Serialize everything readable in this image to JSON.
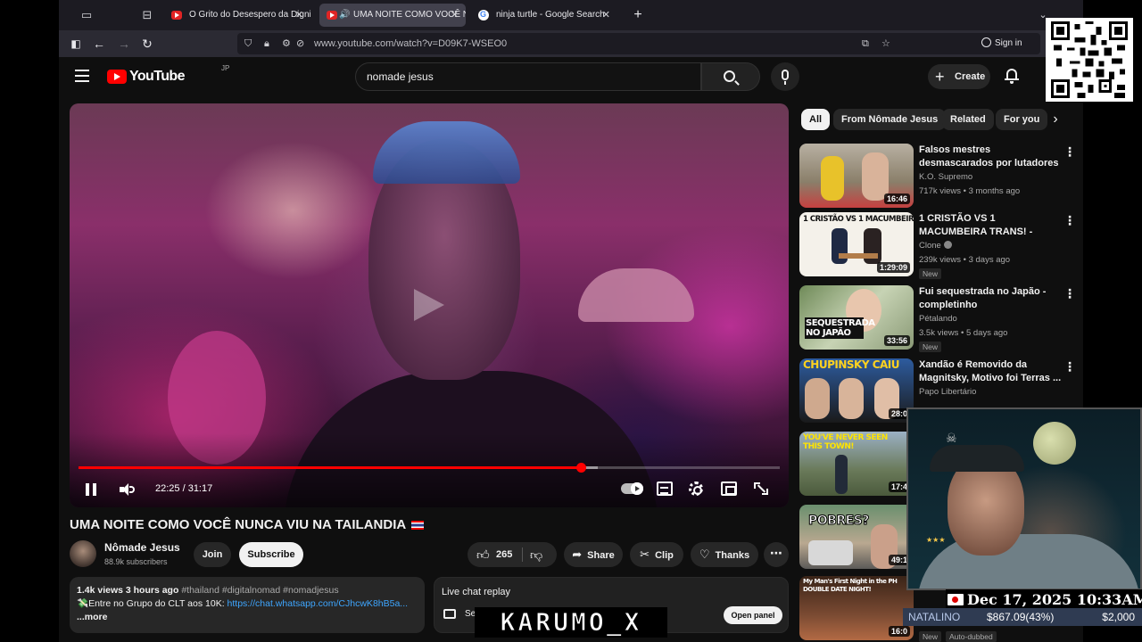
{
  "browser": {
    "tabs": [
      {
        "title": "O Grito do Desespero da Dignid",
        "active": false
      },
      {
        "title": "UMA NOITE COMO VOCÊ N",
        "active": true
      },
      {
        "title": "ninja turtle - Google Search",
        "active": false
      }
    ],
    "url": "www.youtube.com/watch?v=D09K7-WSEO0",
    "sign_in": "Sign in"
  },
  "youtube": {
    "logo": "YouTube",
    "region": "JP",
    "search_query": "nomade jesus",
    "create_label": "Create"
  },
  "player": {
    "current_time": "22:25",
    "duration": "31:17",
    "time_display": "22:25 / 31:17",
    "progress_fraction": 0.7165,
    "buffer_fraction": 0.74
  },
  "video": {
    "title": "UMA NOITE COMO VOCÊ NUNCA VIU NA TAILANDIA",
    "channel": "Nômade Jesus",
    "subscribers": "88.9k subscribers",
    "join": "Join",
    "subscribe": "Subscribe",
    "likes": "265",
    "share": "Share",
    "clip": "Clip",
    "thanks": "Thanks",
    "views_ago": "1.4k views  3 hours ago",
    "tags": "#thailand #digitalnomad #nomadjesus",
    "desc_prefix": "💸Entre no Grupo do CLT aos 10K: ",
    "desc_link": "https://chat.whatsapp.com/CJhcwK8hB5a...",
    "more": "...more"
  },
  "live_chat": {
    "title": "Live chat replay",
    "text": "Se                                  wh  s live.",
    "open_panel": "Open panel"
  },
  "chips": [
    "All",
    "From Nômade Jesus",
    "Related",
    "For you"
  ],
  "recommendations": [
    {
      "title": "Falsos mestres desmascarados por lutadores de verdade",
      "channel": "K.O. Supremo",
      "stats": "717k views • 3 months ago",
      "duration": "16:46",
      "badge": "",
      "verified": false
    },
    {
      "title": "1 CRISTÃO VS 1 MACUMBEIRA TRANS! - CLONE",
      "channel": "Clone",
      "stats": "239k views • 3 days ago",
      "duration": "1:29:09",
      "badge": "New",
      "verified": true,
      "overlay": "1 CRISTÃO VS 1 MACUMBEIRA"
    },
    {
      "title": "Fui sequestrada no Japão - completinho",
      "channel": "Pétalando",
      "stats": "3.5k views • 5 days ago",
      "duration": "33:56",
      "badge": "New",
      "verified": false,
      "overlay": "SEQUESTRADA NO JAPÃO"
    },
    {
      "title": "Xandão é Removido da Magnitsky, Motivo foi Terras ...",
      "channel": "Papo Libertário",
      "stats": "",
      "duration": "28:0",
      "badge": "",
      "verified": false,
      "overlay": "CHUPINSKY CAIU"
    },
    {
      "title": "",
      "channel": "",
      "stats": "",
      "duration": "17:4",
      "badge": "",
      "verified": false,
      "overlay": "YOU'VE NEVER SEEN THIS TOWN!"
    },
    {
      "title": "",
      "channel": "",
      "stats": "",
      "duration": "49:1",
      "badge": "",
      "verified": false,
      "overlay": "POBRES?"
    },
    {
      "title": "",
      "channel": "",
      "stats": "",
      "duration": "16:0",
      "badge": "New",
      "badge2": "Auto-dubbed",
      "verified": false,
      "overlay": "My Man's First Night in the PH DOUBLE DATE NIGHT!"
    }
  ],
  "stream_overlay": {
    "date": "Dec 17, 2025 10:33AM",
    "donor": "NATALINO",
    "amount": "$867.09(43%)",
    "goal": "$2,000",
    "brand": "KARUMO_X"
  },
  "colors": {
    "accent": "#ff0000",
    "link": "#3ea6ff",
    "bg": "#0f0f0f"
  }
}
